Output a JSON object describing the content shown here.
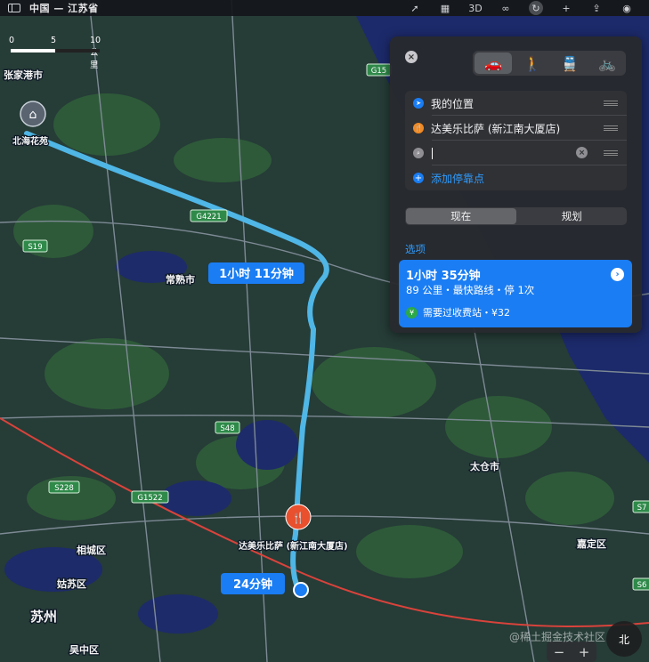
{
  "window": {
    "title": "中国 — 江苏省"
  },
  "toolbar": {
    "icons": [
      "location-arrow-icon",
      "map-icon",
      "3d-toggle",
      "binoculars-icon",
      "directions-icon",
      "plus-icon",
      "share-icon",
      "account-icon"
    ],
    "three_d_label": "3D"
  },
  "scale": {
    "labels": [
      "0",
      "5",
      "10 公里"
    ]
  },
  "map": {
    "colors": {
      "water": "#1c2a6b",
      "land": "#2a3f38",
      "green": "#2e5d3a",
      "route": "#4fb6e6",
      "road": "#7d8a94",
      "rail": "#d9433b"
    },
    "place_labels": [
      "张家港市",
      "北海花苑",
      "常熟市",
      "太仓市",
      "相城区",
      "姑苏区",
      "苏州",
      "吴中区",
      "嘉定区",
      "达美乐比萨 (新江南大厦店)"
    ],
    "road_shields": [
      "G15",
      "G4221",
      "S19",
      "S48",
      "S228",
      "G1522",
      "S7",
      "S6"
    ],
    "route_labels": {
      "main": "1小时 11分钟",
      "secondary": "24分钟"
    }
  },
  "panel": {
    "close_label": "×",
    "transport_modes": [
      "drive-icon",
      "walk-icon",
      "transit-icon",
      "bike-icon"
    ],
    "stops": [
      {
        "label": "我的位置"
      },
      {
        "label": "达美乐比萨 (新江南大厦店)"
      },
      {
        "label": "",
        "placeholder": ""
      }
    ],
    "add_stop": "添加停靠点",
    "segment": [
      "现在",
      "规划"
    ],
    "options_label": "选项",
    "route": {
      "time": "1小时 35分钟",
      "detail": "89 公里・最快路线・停 1次",
      "toll": "需要过收费站・¥32",
      "yen": "¥"
    }
  },
  "zoom": {
    "minus": "−",
    "plus": "+"
  },
  "compass": {
    "label": "北"
  },
  "watermark": "@稀土掘金技术社区"
}
